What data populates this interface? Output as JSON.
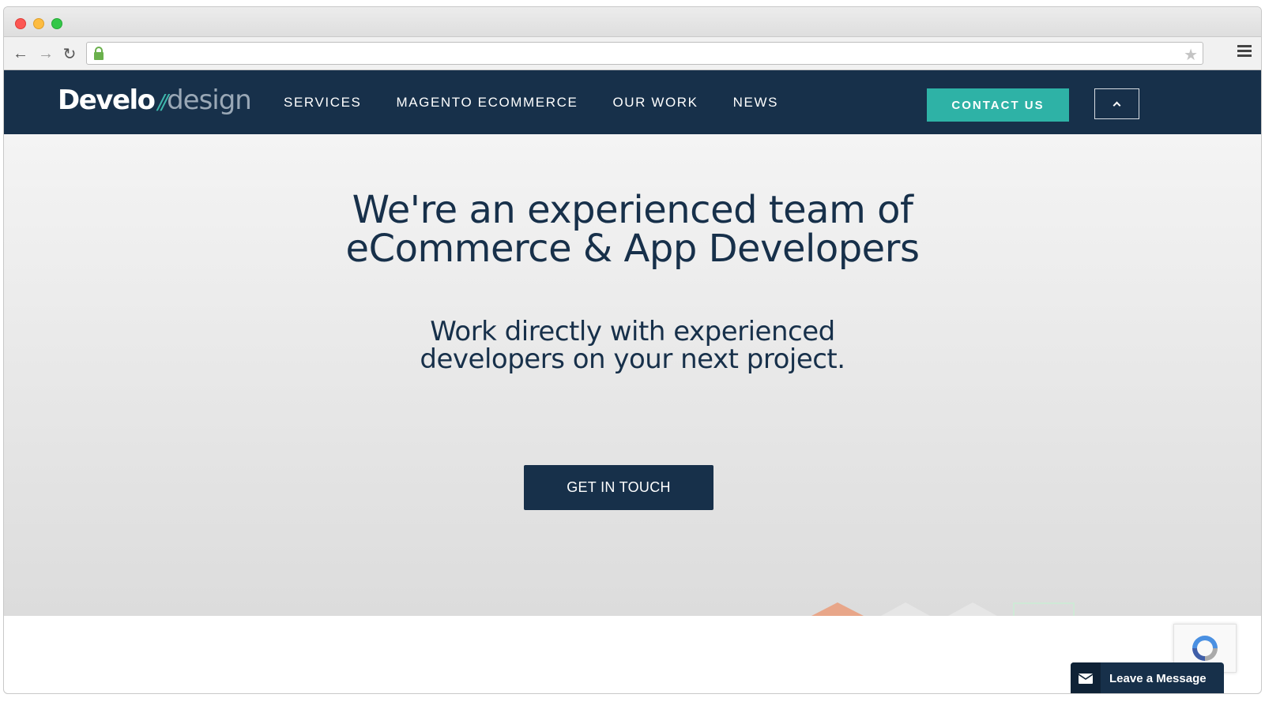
{
  "browser": {
    "url": "",
    "buttons": [
      "back-icon",
      "forward-icon",
      "reload-icon"
    ],
    "icons": [
      "lock-icon",
      "star-icon",
      "menu-icon"
    ]
  },
  "header": {
    "logo_bold": "Develo",
    "logo_slash": "//",
    "logo_light": "design",
    "nav": [
      "SERVICES",
      "MAGENTO ECOMMERCE",
      "OUR WORK",
      "NEWS"
    ],
    "contact_label": "CONTACT US",
    "toggle_icon": "chevron-up-icon"
  },
  "hero": {
    "title_line1": "We're an experienced team of",
    "title_line2": "eCommerce & App Developers",
    "sub_line1": "Work directly with experienced",
    "sub_line2": "developers on your next project.",
    "cta_label": "GET IN TOUCH"
  },
  "widgets": {
    "leave_message": "Leave a Message",
    "recaptcha_icon": "recaptcha-icon",
    "mail_icon": "envelope-icon"
  },
  "colors": {
    "nav_bg": "#17304a",
    "accent": "#2eb2a6",
    "hero_text": "#17304a"
  }
}
